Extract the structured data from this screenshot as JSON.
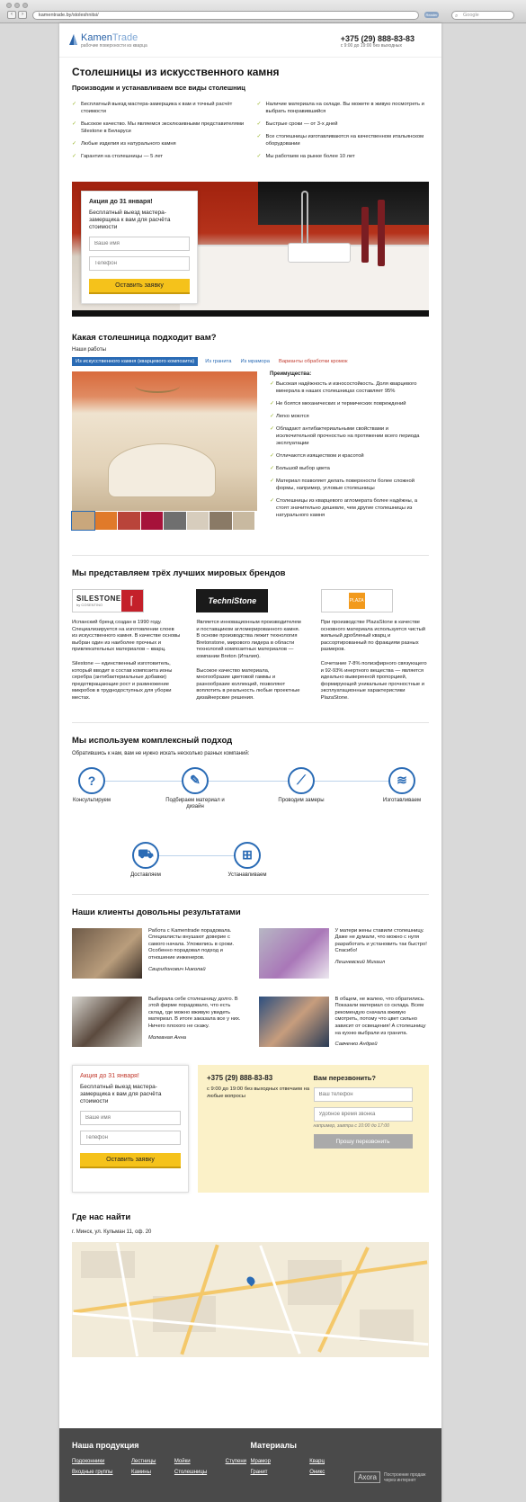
{
  "browser": {
    "url": "kamentrade.by/stoleshnitsi/",
    "reader": "Reader",
    "search_placeholder": "Google"
  },
  "header": {
    "logo_name_a": "Kamen",
    "logo_name_b": "Trade",
    "logo_tagline": "рабочие поверхности из кварца",
    "phone": "+375 (29) 888-83-83",
    "hours": "с 9:00 до 19:00 без выходных"
  },
  "hero": {
    "title": "Столешницы из искусственного камня",
    "subtitle": "Производим и устанавливаем все виды столешниц",
    "checks_left": [
      "Бесплатный выезд мастера-замерщика к вам и точный расчёт стоимости",
      "Высокое качество. Мы являемся эксклюзивными представителями Silestone в Беларуси",
      "Любые изделия из натурального камня",
      "Гарантия на столешницы — 5 лет"
    ],
    "checks_right": [
      "Наличие материала на складе. Вы можете в живую посмотреть и выбрать понравившийся",
      "Быстрые сроки — от 3-х дней",
      "Все столешницы изготавливаются на качественном итальянском оборудовании",
      "Мы работаем на рынке более 10 лет"
    ]
  },
  "form": {
    "promo": "Акция до 31 января!",
    "promo_text": "Бесплатный выезд мастера-замерщика к вам для расчёта стоимости",
    "name_placeholder": "Ваше имя",
    "phone_placeholder": "Телефон",
    "submit": "Оставить заявку"
  },
  "types": {
    "title": "Какая столешница подходит вам?",
    "works_label": "Наши работы",
    "tabs": [
      "Из искусственного камня (кварцевого композита)",
      "Из гранита",
      "Из мрамора",
      "Варианты обработки кромок"
    ],
    "adv_title": "Преимущества:",
    "advantages": [
      "Высокая надёжность и износостойкость. Доля кварцевого минерала в наших столешницах составляет 95%",
      "Не боятся механических и термических повреждений",
      "Легко моются",
      "Обладают антибактериальными свойствами и исключительной прочностью на протяжении всего периода эксплуатации",
      "Отличаются изяществом и красотой",
      "Большой выбор цвета",
      "Материал позволяет делать поверхности более сложной формы, например, угловые столешницы",
      "Столешницы из кварцевого агломерата более надёжны, а стоят значительно дешевле, чем другие столешницы из натурального камня"
    ]
  },
  "brands": {
    "title": "Мы представляем трёх лучших мировых брендов",
    "silestone_logo": "SILESTONE",
    "silestone_sub": "by COSENTINO",
    "techni_logo": "TechniStone",
    "plaza_logo": "PLAZA",
    "items": [
      {
        "p1": "Испанский бренд создан в 1990 году. Специализируется на изготовлении слоев из искусственного камня. В качестве основы выбран один из наиболее прочных и привлекательных материалов – кварц.",
        "p2": "Silestone — единственный изготовитель, который вводит в состав композита ионы серебра (антибактериальные добавки) предотвращающие рост и размножение микробов в труднодоступных для уборки местах."
      },
      {
        "p1": "Является инновационным производителем и поставщиком агломерированного камня. В основе производства лежит технология Bretonstone, мирового лидера в области технологий композитных материалов — компании Breton (Италия).",
        "p2": "Высокое качество материала, многообразие цветовой гаммы и разнообразие коллекций, позволяют воплотить в реальность любые проектные дизайнерские решения."
      },
      {
        "p1": "При производстве PlazaStone в качестве основного материала используется чистый жильный дробленый кварц и рассортированный по фракциям разных размеров.",
        "p2": "Сочетание 7-8% полиэфирного связующего и 92-93% инертного вещества — является идеально выверенной пропорцией, формирующей уникальные прочностные и эксплуатационные характеристики PlazaStone."
      }
    ]
  },
  "approach": {
    "title": "Мы используем комплексный подход",
    "intro": "Обратившись к нам, вам не нужно искать несколько разных компаний:",
    "steps": [
      {
        "icon": "question-icon",
        "label": "Консультируем"
      },
      {
        "icon": "tools-icon",
        "label": "Подбираем материал и дизайн"
      },
      {
        "icon": "ruler-icon",
        "label": "Проводим замеры"
      },
      {
        "icon": "layers-icon",
        "label": "Изготавливаем"
      },
      {
        "icon": "cart-icon",
        "label": "Доставляем"
      },
      {
        "icon": "install-icon",
        "label": "Устанавливаем"
      }
    ]
  },
  "reviews": {
    "title": "Наши клиенты довольны результатами",
    "items": [
      {
        "text": "Работа с Kamentrade порадовала. Специалисты внушают доверие с самого начала. Уложились в сроки. Особенно порадовал подход и отношение инженеров.",
        "author": "Свиридонович Николай"
      },
      {
        "text": "У матери жены ставили столешницу. Даже не думали, что можно с нуля разработать и установить так быстро! Спасибо!",
        "author": "Лешневский Михаил"
      },
      {
        "text": "Выбирала себе столешницу долго. В этой фирме порадовало, что есть склад, где можно вживую увидеть материал. В итоге заказала все у них. Ничего плохого не скажу.",
        "author": "Молевная Анна"
      },
      {
        "text": "В общем, не жалею, что обратились. Показали материал со склада. Всем рекомендую сначала вживую смотреть, потому что цвет сильно зависит от освещения! А столешницу на кухню выбрали из гранита.",
        "author": "Савченко Андрей"
      }
    ]
  },
  "callback": {
    "phone": "+375 (29) 888-83-83",
    "hours": "с 9:00 до 19:00 без выходных отвечаем на любые вопросы",
    "question": "Вам перезвонить?",
    "phone_placeholder": "Ваш телефон",
    "time_placeholder": "Удобное время звонка",
    "time_hint": "например, завтра с 10:00 до 17:00",
    "submit": "Прошу перезвонить"
  },
  "location": {
    "title": "Где нас найти",
    "address": "г. Минск, ул. Кульман 11, оф. 20"
  },
  "footer": {
    "products_title": "Наша продукция",
    "products": [
      "Подоконники",
      "Лестницы",
      "Мойки",
      "Ступени",
      "Входные группы",
      "Камины",
      "Столешницы"
    ],
    "materials_title": "Материалы",
    "materials": [
      "Мрамор",
      "Кварц",
      "Гранит",
      "Оникс"
    ],
    "dev_logo": "Axora",
    "dev_text": "Построение продаж через интернет"
  }
}
